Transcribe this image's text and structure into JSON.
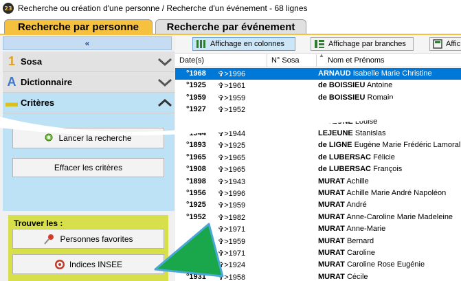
{
  "window": {
    "title": "Recherche ou création d'une personne / Recherche d'un événement - 68 lignes",
    "app_icon_text": "23"
  },
  "tabs": [
    {
      "label": "Recherche par personne",
      "active": true
    },
    {
      "label": "Recherche par événement",
      "active": false
    }
  ],
  "left_panel": {
    "collapse_glyph": "«",
    "sections": [
      {
        "label": "Sosa",
        "icon": "sosa-icon",
        "expanded": false
      },
      {
        "label": "Dictionnaire",
        "icon": "dictionary-icon",
        "expanded": false
      },
      {
        "label": "Critères",
        "icon": "criteria-icon",
        "expanded": true
      }
    ],
    "launch_label": "Lancer la recherche",
    "clear_label": "Effacer les critères",
    "trouver_label": "Trouver les :",
    "favorites_label": "Personnes favorites",
    "insee_label": "Indices INSEE"
  },
  "toolbar": {
    "columns_label": "Affichage en colonnes",
    "branches_label": "Affichage par branches",
    "other_label": "Affic"
  },
  "table": {
    "headers": {
      "date": "Date(s)",
      "sosa": "N° Sosa",
      "name": "Nom et Prénoms"
    },
    "rows": [
      {
        "birth": "°1968",
        "death": "✞>1996",
        "surname": "ARNAUD",
        "given": "Isabelle Marie Christine",
        "selected": true
      },
      {
        "birth": "°1925",
        "death": "✞>1961",
        "surname": "de BOISSIEU",
        "given": "Antoine",
        "selected": false
      },
      {
        "birth": "°1959",
        "death": "✞>1959",
        "surname": "de BOISSIEU",
        "given": "Romain",
        "selected": false
      },
      {
        "birth": "°1927",
        "death": "✞>1952",
        "surname": "",
        "given": "",
        "selected": false
      },
      {
        "birth": "",
        "death": "",
        "surname": "LEJEUNE",
        "given": "Louise",
        "selected": false
      },
      {
        "birth": "°1944",
        "death": "✞>1944",
        "surname": "LEJEUNE",
        "given": "Stanislas",
        "selected": false
      },
      {
        "birth": "°1893",
        "death": "✞>1925",
        "surname": "de LIGNE",
        "given": "Eugène Marie Frédéric Lamoral",
        "selected": false
      },
      {
        "birth": "°1965",
        "death": "✞>1965",
        "surname": "de LUBERSAC",
        "given": "Félicie",
        "selected": false
      },
      {
        "birth": "°1908",
        "death": "✞>1965",
        "surname": "de LUBERSAC",
        "given": "François",
        "selected": false
      },
      {
        "birth": "°1898",
        "death": "✞>1943",
        "surname": "MURAT",
        "given": "Achille",
        "selected": false
      },
      {
        "birth": "°1956",
        "death": "✞>1996",
        "surname": "MURAT",
        "given": "Achille Marie André Napoléon",
        "selected": false
      },
      {
        "birth": "°1925",
        "death": "✞>1959",
        "surname": "MURAT",
        "given": "André",
        "selected": false
      },
      {
        "birth": "°1952",
        "death": "✞>1982",
        "surname": "MURAT",
        "given": "Anne-Caroline Marie Madeleine",
        "selected": false
      },
      {
        "birth": "",
        "death": "✞>1971",
        "surname": "MURAT",
        "given": "Anne-Marie",
        "selected": false
      },
      {
        "birth": "",
        "death": "✞>1959",
        "surname": "MURAT",
        "given": "Bernard",
        "selected": false
      },
      {
        "birth": "",
        "death": "✞>1971",
        "surname": "MURAT",
        "given": "Caroline",
        "selected": false
      },
      {
        "birth": "",
        "death": "✞>1924",
        "surname": "MURAT",
        "given": "Caroline Rose Eugénie",
        "selected": false
      },
      {
        "birth": "°1931",
        "death": "✞>1958",
        "surname": "MURAT",
        "given": "Cécile",
        "selected": false
      }
    ]
  },
  "colors": {
    "tab_active": "#f7c140",
    "selection": "#0078d7",
    "criteria_bg": "#bde1f5",
    "trouver_bg": "#d7e04a",
    "arrow_green": "#1aa64a",
    "arrow_outline": "#4aa8d8"
  }
}
